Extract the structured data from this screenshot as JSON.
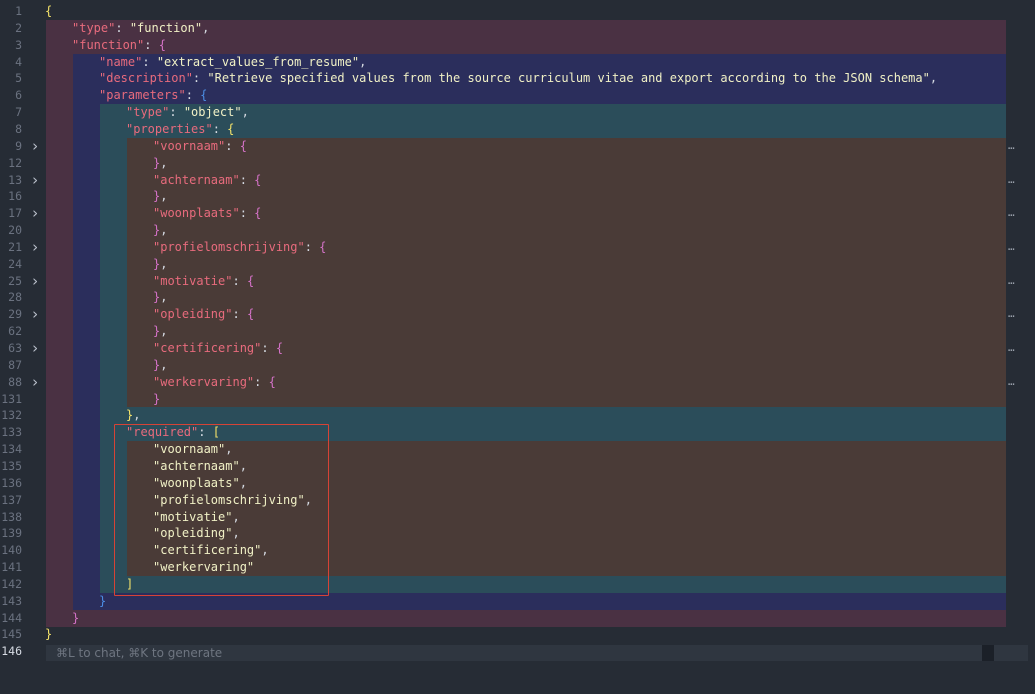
{
  "editor": {
    "lines": [
      {
        "n": "1",
        "tokens": [
          [
            "b1",
            "{"
          ]
        ]
      },
      {
        "n": "2",
        "tokens": [
          [
            "k",
            "\"type\""
          ],
          [
            "p",
            ": "
          ],
          [
            "s",
            "\"function\""
          ],
          [
            "p",
            ","
          ]
        ]
      },
      {
        "n": "3",
        "tokens": [
          [
            "k",
            "\"function\""
          ],
          [
            "p",
            ": "
          ],
          [
            "b2",
            "{"
          ]
        ]
      },
      {
        "n": "4",
        "tokens": [
          [
            "k",
            "\"name\""
          ],
          [
            "p",
            ": "
          ],
          [
            "s",
            "\"extract_values_from_resume\""
          ],
          [
            "p",
            ","
          ]
        ]
      },
      {
        "n": "5",
        "tokens": [
          [
            "k",
            "\"description\""
          ],
          [
            "p",
            ": "
          ],
          [
            "s",
            "\"Retrieve specified values from the source curriculum vitae and export according to the JSON schema\""
          ],
          [
            "p",
            ","
          ]
        ]
      },
      {
        "n": "6",
        "tokens": [
          [
            "k",
            "\"parameters\""
          ],
          [
            "p",
            ": "
          ],
          [
            "b3",
            "{"
          ]
        ]
      },
      {
        "n": "7",
        "tokens": [
          [
            "k",
            "\"type\""
          ],
          [
            "p",
            ": "
          ],
          [
            "s",
            "\"object\""
          ],
          [
            "p",
            ","
          ]
        ]
      },
      {
        "n": "8",
        "tokens": [
          [
            "k",
            "\"properties\""
          ],
          [
            "p",
            ": "
          ],
          [
            "b1",
            "{"
          ]
        ]
      },
      {
        "n": "9",
        "fold": true,
        "tokens": [
          [
            "k",
            "\"voornaam\""
          ],
          [
            "p",
            ": "
          ],
          [
            "b2",
            "{"
          ]
        ]
      },
      {
        "n": "12",
        "tokens": [
          [
            "b2",
            "}"
          ],
          [
            "p",
            ","
          ]
        ]
      },
      {
        "n": "13",
        "fold": true,
        "tokens": [
          [
            "k",
            "\"achternaam\""
          ],
          [
            "p",
            ": "
          ],
          [
            "b2",
            "{"
          ]
        ]
      },
      {
        "n": "16",
        "tokens": [
          [
            "b2",
            "}"
          ],
          [
            "p",
            ","
          ]
        ]
      },
      {
        "n": "17",
        "fold": true,
        "tokens": [
          [
            "k",
            "\"woonplaats\""
          ],
          [
            "p",
            ": "
          ],
          [
            "b2",
            "{"
          ]
        ]
      },
      {
        "n": "20",
        "tokens": [
          [
            "b2",
            "}"
          ],
          [
            "p",
            ","
          ]
        ]
      },
      {
        "n": "21",
        "fold": true,
        "tokens": [
          [
            "k",
            "\"profielomschrijving\""
          ],
          [
            "p",
            ": "
          ],
          [
            "b2",
            "{"
          ]
        ]
      },
      {
        "n": "24",
        "tokens": [
          [
            "b2",
            "}"
          ],
          [
            "p",
            ","
          ]
        ]
      },
      {
        "n": "25",
        "fold": true,
        "tokens": [
          [
            "k",
            "\"motivatie\""
          ],
          [
            "p",
            ": "
          ],
          [
            "b2",
            "{"
          ]
        ]
      },
      {
        "n": "28",
        "tokens": [
          [
            "b2",
            "}"
          ],
          [
            "p",
            ","
          ]
        ]
      },
      {
        "n": "29",
        "fold": true,
        "tokens": [
          [
            "k",
            "\"opleiding\""
          ],
          [
            "p",
            ": "
          ],
          [
            "b2",
            "{"
          ]
        ]
      },
      {
        "n": "62",
        "tokens": [
          [
            "b2",
            "}"
          ],
          [
            "p",
            ","
          ]
        ]
      },
      {
        "n": "63",
        "fold": true,
        "tokens": [
          [
            "k",
            "\"certificering\""
          ],
          [
            "p",
            ": "
          ],
          [
            "b2",
            "{"
          ]
        ]
      },
      {
        "n": "87",
        "tokens": [
          [
            "b2",
            "}"
          ],
          [
            "p",
            ","
          ]
        ]
      },
      {
        "n": "88",
        "fold": true,
        "tokens": [
          [
            "k",
            "\"werkervaring\""
          ],
          [
            "p",
            ": "
          ],
          [
            "b2",
            "{"
          ]
        ]
      },
      {
        "n": "131",
        "tokens": [
          [
            "b2",
            "}"
          ]
        ]
      },
      {
        "n": "132",
        "tokens": [
          [
            "b1",
            "}"
          ],
          [
            "p",
            ","
          ]
        ]
      },
      {
        "n": "133",
        "tokens": [
          [
            "k",
            "\"required\""
          ],
          [
            "p",
            ": "
          ],
          [
            "b1",
            "["
          ]
        ]
      },
      {
        "n": "134",
        "tokens": [
          [
            "s",
            "\"voornaam\""
          ],
          [
            "p",
            ","
          ]
        ]
      },
      {
        "n": "135",
        "tokens": [
          [
            "s",
            "\"achternaam\""
          ],
          [
            "p",
            ","
          ]
        ]
      },
      {
        "n": "136",
        "tokens": [
          [
            "s",
            "\"woonplaats\""
          ],
          [
            "p",
            ","
          ]
        ]
      },
      {
        "n": "137",
        "tokens": [
          [
            "s",
            "\"profielomschrijving\""
          ],
          [
            "p",
            ","
          ]
        ]
      },
      {
        "n": "138",
        "tokens": [
          [
            "s",
            "\"motivatie\""
          ],
          [
            "p",
            ","
          ]
        ]
      },
      {
        "n": "139",
        "tokens": [
          [
            "s",
            "\"opleiding\""
          ],
          [
            "p",
            ","
          ]
        ]
      },
      {
        "n": "140",
        "tokens": [
          [
            "s",
            "\"certificering\""
          ],
          [
            "p",
            ","
          ]
        ]
      },
      {
        "n": "141",
        "tokens": [
          [
            "s",
            "\"werkervaring\""
          ]
        ]
      },
      {
        "n": "142",
        "tokens": [
          [
            "b1",
            "]"
          ]
        ]
      },
      {
        "n": "143",
        "tokens": [
          [
            "b3",
            "}"
          ]
        ]
      },
      {
        "n": "144",
        "tokens": [
          [
            "b2",
            "}"
          ]
        ]
      },
      {
        "n": "145",
        "tokens": [
          [
            "b1",
            "}"
          ]
        ]
      },
      {
        "n": "146",
        "active": true,
        "tokens": []
      }
    ],
    "folded_marker": "…",
    "fold_icon": "chevron-right-icon"
  },
  "chat_bar": {
    "hint": "⌘L to chat, ⌘K to generate"
  },
  "colors": {
    "background": "#262c35",
    "level1": "#4a3143",
    "level2": "#2b2e5c",
    "level3": "#2b4d5a",
    "level4": "#4a3b37",
    "highlight_box": "#d64336"
  }
}
